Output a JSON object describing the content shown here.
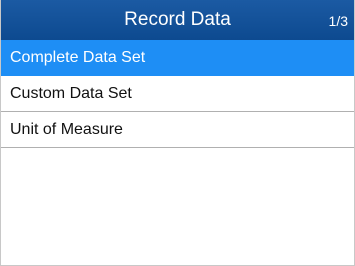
{
  "header": {
    "title": "Record Data",
    "page": "1/3"
  },
  "menu": {
    "items": [
      {
        "label": "Complete Data Set",
        "selected": true
      },
      {
        "label": "Custom Data Set",
        "selected": false
      },
      {
        "label": "Unit of Measure",
        "selected": false
      }
    ]
  },
  "colors": {
    "title_bar": "#114f97",
    "selection": "#1e8ef5",
    "divider": "#b0b0b0"
  }
}
